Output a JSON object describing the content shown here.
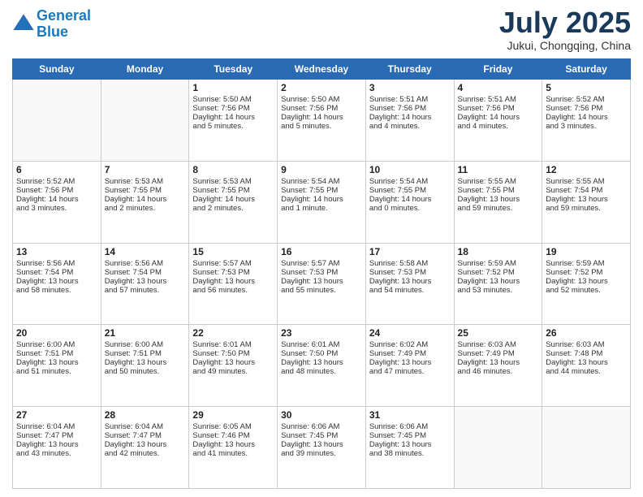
{
  "logo": {
    "line1": "General",
    "line2": "Blue"
  },
  "header": {
    "month": "July 2025",
    "location": "Jukui, Chongqing, China"
  },
  "weekdays": [
    "Sunday",
    "Monday",
    "Tuesday",
    "Wednesday",
    "Thursday",
    "Friday",
    "Saturday"
  ],
  "weeks": [
    [
      {
        "day": "",
        "text": ""
      },
      {
        "day": "",
        "text": ""
      },
      {
        "day": "1",
        "text": "Sunrise: 5:50 AM\nSunset: 7:56 PM\nDaylight: 14 hours\nand 5 minutes."
      },
      {
        "day": "2",
        "text": "Sunrise: 5:50 AM\nSunset: 7:56 PM\nDaylight: 14 hours\nand 5 minutes."
      },
      {
        "day": "3",
        "text": "Sunrise: 5:51 AM\nSunset: 7:56 PM\nDaylight: 14 hours\nand 4 minutes."
      },
      {
        "day": "4",
        "text": "Sunrise: 5:51 AM\nSunset: 7:56 PM\nDaylight: 14 hours\nand 4 minutes."
      },
      {
        "day": "5",
        "text": "Sunrise: 5:52 AM\nSunset: 7:56 PM\nDaylight: 14 hours\nand 3 minutes."
      }
    ],
    [
      {
        "day": "6",
        "text": "Sunrise: 5:52 AM\nSunset: 7:56 PM\nDaylight: 14 hours\nand 3 minutes."
      },
      {
        "day": "7",
        "text": "Sunrise: 5:53 AM\nSunset: 7:55 PM\nDaylight: 14 hours\nand 2 minutes."
      },
      {
        "day": "8",
        "text": "Sunrise: 5:53 AM\nSunset: 7:55 PM\nDaylight: 14 hours\nand 2 minutes."
      },
      {
        "day": "9",
        "text": "Sunrise: 5:54 AM\nSunset: 7:55 PM\nDaylight: 14 hours\nand 1 minute."
      },
      {
        "day": "10",
        "text": "Sunrise: 5:54 AM\nSunset: 7:55 PM\nDaylight: 14 hours\nand 0 minutes."
      },
      {
        "day": "11",
        "text": "Sunrise: 5:55 AM\nSunset: 7:55 PM\nDaylight: 13 hours\nand 59 minutes."
      },
      {
        "day": "12",
        "text": "Sunrise: 5:55 AM\nSunset: 7:54 PM\nDaylight: 13 hours\nand 59 minutes."
      }
    ],
    [
      {
        "day": "13",
        "text": "Sunrise: 5:56 AM\nSunset: 7:54 PM\nDaylight: 13 hours\nand 58 minutes."
      },
      {
        "day": "14",
        "text": "Sunrise: 5:56 AM\nSunset: 7:54 PM\nDaylight: 13 hours\nand 57 minutes."
      },
      {
        "day": "15",
        "text": "Sunrise: 5:57 AM\nSunset: 7:53 PM\nDaylight: 13 hours\nand 56 minutes."
      },
      {
        "day": "16",
        "text": "Sunrise: 5:57 AM\nSunset: 7:53 PM\nDaylight: 13 hours\nand 55 minutes."
      },
      {
        "day": "17",
        "text": "Sunrise: 5:58 AM\nSunset: 7:53 PM\nDaylight: 13 hours\nand 54 minutes."
      },
      {
        "day": "18",
        "text": "Sunrise: 5:59 AM\nSunset: 7:52 PM\nDaylight: 13 hours\nand 53 minutes."
      },
      {
        "day": "19",
        "text": "Sunrise: 5:59 AM\nSunset: 7:52 PM\nDaylight: 13 hours\nand 52 minutes."
      }
    ],
    [
      {
        "day": "20",
        "text": "Sunrise: 6:00 AM\nSunset: 7:51 PM\nDaylight: 13 hours\nand 51 minutes."
      },
      {
        "day": "21",
        "text": "Sunrise: 6:00 AM\nSunset: 7:51 PM\nDaylight: 13 hours\nand 50 minutes."
      },
      {
        "day": "22",
        "text": "Sunrise: 6:01 AM\nSunset: 7:50 PM\nDaylight: 13 hours\nand 49 minutes."
      },
      {
        "day": "23",
        "text": "Sunrise: 6:01 AM\nSunset: 7:50 PM\nDaylight: 13 hours\nand 48 minutes."
      },
      {
        "day": "24",
        "text": "Sunrise: 6:02 AM\nSunset: 7:49 PM\nDaylight: 13 hours\nand 47 minutes."
      },
      {
        "day": "25",
        "text": "Sunrise: 6:03 AM\nSunset: 7:49 PM\nDaylight: 13 hours\nand 46 minutes."
      },
      {
        "day": "26",
        "text": "Sunrise: 6:03 AM\nSunset: 7:48 PM\nDaylight: 13 hours\nand 44 minutes."
      }
    ],
    [
      {
        "day": "27",
        "text": "Sunrise: 6:04 AM\nSunset: 7:47 PM\nDaylight: 13 hours\nand 43 minutes."
      },
      {
        "day": "28",
        "text": "Sunrise: 6:04 AM\nSunset: 7:47 PM\nDaylight: 13 hours\nand 42 minutes."
      },
      {
        "day": "29",
        "text": "Sunrise: 6:05 AM\nSunset: 7:46 PM\nDaylight: 13 hours\nand 41 minutes."
      },
      {
        "day": "30",
        "text": "Sunrise: 6:06 AM\nSunset: 7:45 PM\nDaylight: 13 hours\nand 39 minutes."
      },
      {
        "day": "31",
        "text": "Sunrise: 6:06 AM\nSunset: 7:45 PM\nDaylight: 13 hours\nand 38 minutes."
      },
      {
        "day": "",
        "text": ""
      },
      {
        "day": "",
        "text": ""
      }
    ]
  ]
}
